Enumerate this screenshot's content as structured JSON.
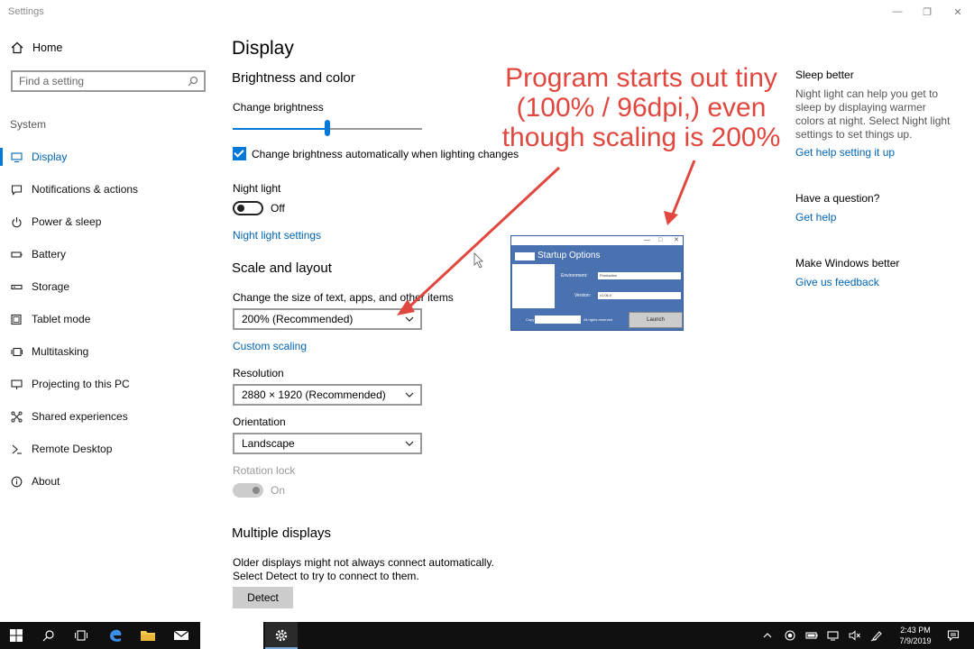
{
  "window": {
    "title": "Settings",
    "minimize_glyph": "—",
    "maximize_glyph": "❐",
    "close_glyph": "✕"
  },
  "nav": {
    "home_label": "Home",
    "search_placeholder": "Find a setting",
    "section_label": "System",
    "items": [
      {
        "label": "Display",
        "icon": "monitor-icon",
        "active": true
      },
      {
        "label": "Notifications & actions",
        "icon": "notification-icon"
      },
      {
        "label": "Power & sleep",
        "icon": "power-icon"
      },
      {
        "label": "Battery",
        "icon": "battery-icon"
      },
      {
        "label": "Storage",
        "icon": "storage-icon"
      },
      {
        "label": "Tablet mode",
        "icon": "tablet-icon"
      },
      {
        "label": "Multitasking",
        "icon": "multitasking-icon"
      },
      {
        "label": "Projecting to this PC",
        "icon": "projecting-icon"
      },
      {
        "label": "Shared experiences",
        "icon": "shared-icon"
      },
      {
        "label": "Remote Desktop",
        "icon": "remote-desktop-icon"
      },
      {
        "label": "About",
        "icon": "info-icon"
      }
    ]
  },
  "main": {
    "title": "Display",
    "brightness": {
      "heading": "Brightness and color",
      "slider_label": "Change brightness",
      "slider_value": 0.5,
      "auto_checkbox_label": "Change brightness automatically when lighting changes",
      "auto_checked": true
    },
    "night_light": {
      "label": "Night light",
      "state": "Off",
      "settings_link": "Night light settings"
    },
    "scale": {
      "heading": "Scale and layout",
      "size_label": "Change the size of text, apps, and other items",
      "size_value": "200% (Recommended)",
      "custom_link": "Custom scaling",
      "resolution_label": "Resolution",
      "resolution_value": "2880 × 1920 (Recommended)",
      "orientation_label": "Orientation",
      "orientation_value": "Landscape",
      "rotation_label": "Rotation lock",
      "rotation_state": "On"
    },
    "multiple": {
      "heading": "Multiple displays",
      "description": "Older displays might not always connect automatically. Select Detect to try to connect to them.",
      "detect_button": "Detect"
    }
  },
  "right": {
    "sleep_heading": "Sleep better",
    "sleep_text": "Night light can help you get to sleep by displaying warmer colors at night. Select Night light settings to set things up.",
    "sleep_link": "Get help setting it up",
    "question_heading": "Have a question?",
    "question_link": "Get help",
    "better_heading": "Make Windows better",
    "better_link": "Give us feedback"
  },
  "annotation": {
    "text": "Program starts out tiny\n(100% / 96dpi,)  even\nthough scaling is 200%",
    "color": "#e0483f"
  },
  "startup_window": {
    "title": "Startup Options",
    "environment_label": "Environment:",
    "environment_value": "Production",
    "version_label": "Version:",
    "version_value": "v1.06.0",
    "copyright_prefix": "Copy",
    "rights_text": "All rights reserved",
    "launch_button": "Launch",
    "min_glyph": "—",
    "max_glyph": "□",
    "close_glyph": "✕"
  },
  "taskbar": {
    "time": "2:43 PM",
    "date": "7/9/2019",
    "icons": [
      "windows-start-icon",
      "search-icon",
      "task-view-icon",
      "edge-icon",
      "file-explorer-icon",
      "mail-icon",
      "settings-icon"
    ],
    "tray_icons": [
      "chevron-up-icon",
      "record-icon",
      "battery-icon",
      "network-icon",
      "volume-icon",
      "pen-icon",
      "action-center-icon"
    ]
  },
  "colors": {
    "accent": "#0078d7",
    "link": "#0063b1",
    "taskbar": "#101010",
    "app_window": "#4a72b0"
  }
}
